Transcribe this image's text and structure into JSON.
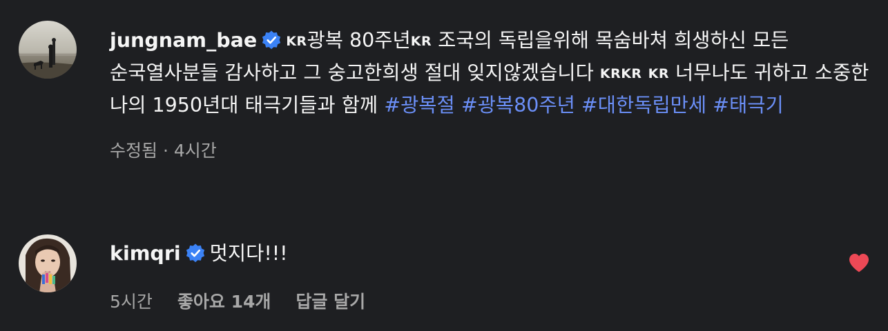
{
  "post": {
    "username": "jungnam_bae",
    "flag1": "KR",
    "text1": "광복 80주년",
    "flag2": "KR",
    "text2": " 조국의 독립을위해 목숨바쳐 희생하신 모든 순국열사분들 감사하고 그 숭고한희생 절대 잊지않겠습니다 ",
    "flag3": "KRKR",
    "flag4": "KR",
    "text3": " 너무나도 귀하고 소중한 나의 1950년대 태극기들과 함께 ",
    "hashtags": [
      "#광복절",
      "#광복80주년",
      "#대한독립만세",
      "#태극기"
    ],
    "meta": "수정됨 · 4시간",
    "verified_icon": "verified-badge-icon",
    "accent_color": "#6b8ff7"
  },
  "comment": {
    "username": "kimqri",
    "text": "멋지다!!!",
    "time": "5시간",
    "likes": "좋아요 14개",
    "reply": "답글 달기",
    "liked_icon": "heart-filled-icon",
    "heart_color": "#ed4956"
  }
}
